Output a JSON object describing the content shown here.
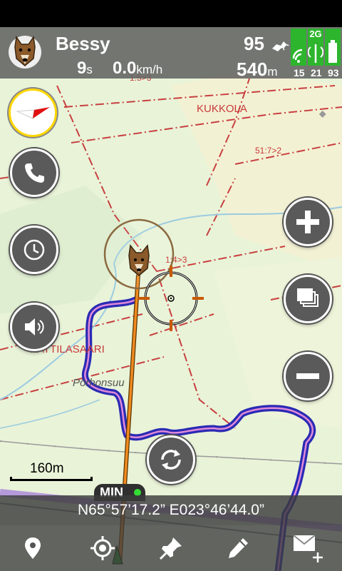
{
  "dog": {
    "name": "Bessy",
    "icon": "dog-face-icon"
  },
  "tracking": {
    "elapsed_value": "9",
    "elapsed_unit": "s",
    "speed_value": "0.0",
    "speed_unit": "km/h",
    "battery_value": "95",
    "distance_value": "540",
    "distance_unit": "m"
  },
  "signal": {
    "network_label": "2G",
    "counts": [
      "15",
      "21",
      "93"
    ],
    "color": "#2db52d"
  },
  "map": {
    "labels": [
      "KUKKOLA",
      "51:7>2",
      "1:4>3",
      "1:5>3",
      "KATTILASAARI",
      "Pörhonsuu"
    ],
    "scale_label": "160m"
  },
  "markers": {
    "min_label": "MIN"
  },
  "coordinates": "N65°57’17.2” E023°46’44.0”",
  "buttons": {
    "side_left": [
      "compass-button",
      "call-button",
      "clock-button",
      "sound-button"
    ],
    "side_right": [
      "zoom-in-button",
      "layers-button",
      "zoom-out-button"
    ],
    "bottom": [
      "location-pin-icon",
      "gps-target-icon",
      "pushpin-icon",
      "pencil-icon",
      "mail-add-icon"
    ]
  },
  "colors": {
    "track": "#2a2ab5",
    "track_inner": "#e08ad8",
    "line_to_dog": "#e07a10",
    "parcel": "#c84040"
  }
}
